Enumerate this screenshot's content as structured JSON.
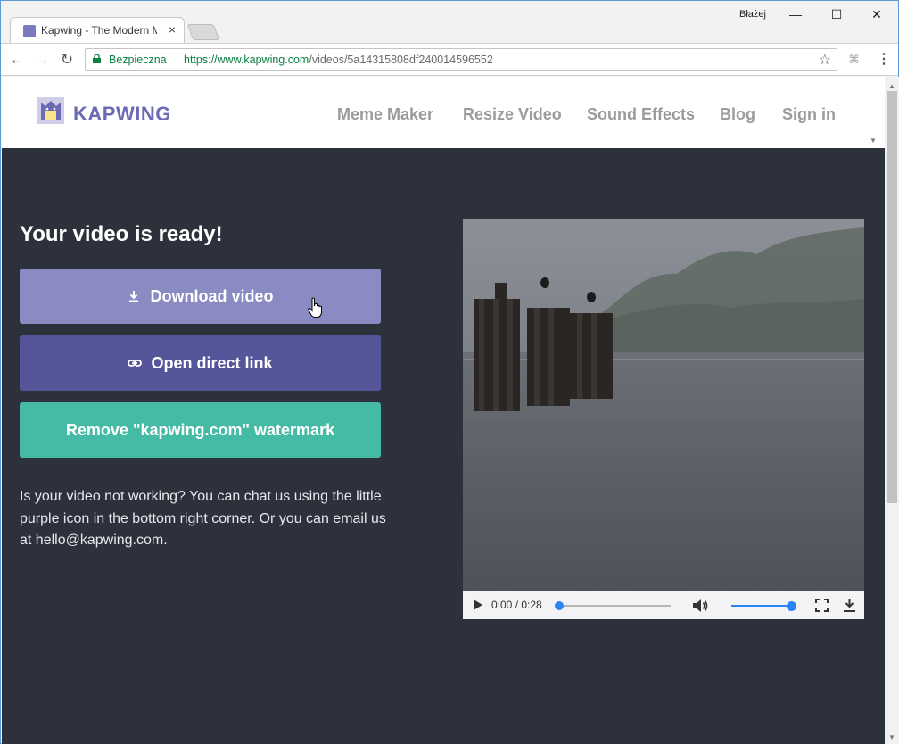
{
  "browser": {
    "tab_title": "Kapwing - The Modern M",
    "tab_close": "×",
    "profile_name": "Błażej",
    "window_controls": {
      "minimize": "—",
      "maximize": "☐",
      "close": "✕"
    },
    "nav": {
      "back": "←",
      "forward": "→",
      "reload": "↻",
      "menu": "⋮"
    },
    "secure_label": "Bezpieczna",
    "url_host": "https://www.kapwing.com",
    "url_path": "/videos/5a14315808df240014596552",
    "star": "☆",
    "extension": "⌘"
  },
  "site": {
    "logo_text": "KAPWING",
    "nav_links": [
      "Meme Maker",
      "Resize Video",
      "Sound Effects",
      "Blog",
      "Sign in"
    ]
  },
  "main": {
    "headline": "Your video is ready!",
    "download_label": "Download video",
    "open_link_label": "Open direct link",
    "watermark_label": "Remove \"kapwing.com\" watermark",
    "help_text": "Is your video not working? You can chat us using the little purple icon in the bottom right corner. Or you can email us at hello@kapwing.com."
  },
  "player": {
    "time": "0:00 / 0:28",
    "progress": 0,
    "volume": 1
  },
  "colors": {
    "page_bg": "#2d313c",
    "brand": "#6c6ab5",
    "download_btn": "#8b8bc4",
    "link_btn": "#55569a",
    "watermark_btn": "#45bba5",
    "player_accent": "#2c84f4",
    "secure_green": "#0b8043"
  },
  "icons": {
    "favicon": "kapwing-cat-icon",
    "lock": "lock-icon",
    "download": "download-icon",
    "link": "link-icon",
    "play": "play-icon",
    "volume": "volume-icon",
    "fullscreen": "fullscreen-icon",
    "player_download": "download-icon",
    "cursor": "hand-cursor-icon"
  }
}
